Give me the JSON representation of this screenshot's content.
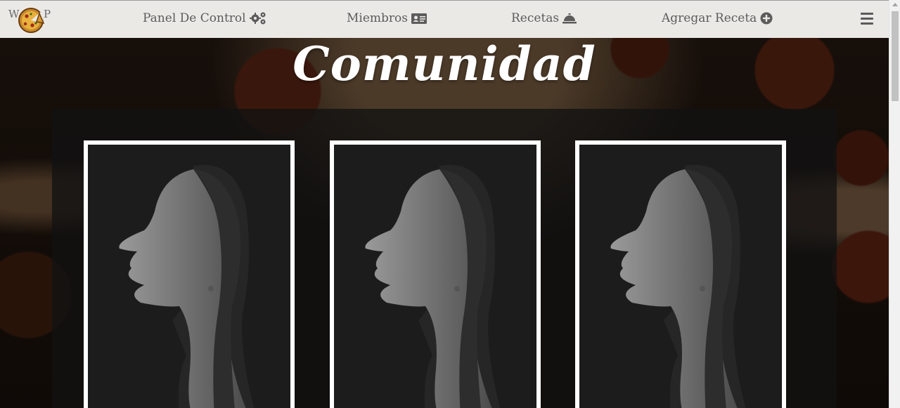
{
  "navbar": {
    "logo_left": "W",
    "logo_right": "P",
    "items": [
      {
        "label": "Panel De Control",
        "icon": "gears-icon"
      },
      {
        "label": "Miembros",
        "icon": "id-card-icon"
      },
      {
        "label": "Recetas",
        "icon": "bell-icon"
      },
      {
        "label": "Agregar Receta",
        "icon": "plus-circle-icon"
      }
    ],
    "menu_icon": "hamburger-icon"
  },
  "main": {
    "title": "Comunidad",
    "members": [
      {
        "photo": "woman-portrait-image"
      },
      {
        "photo": "woman-portrait-image"
      },
      {
        "photo": "woman-portrait-image"
      }
    ]
  },
  "colors": {
    "navbar_bg": "#ebe9e6",
    "nav_text": "#5c5c5c",
    "title": "#ffffff",
    "card_border": "#ffffff",
    "panel": "#121212"
  }
}
